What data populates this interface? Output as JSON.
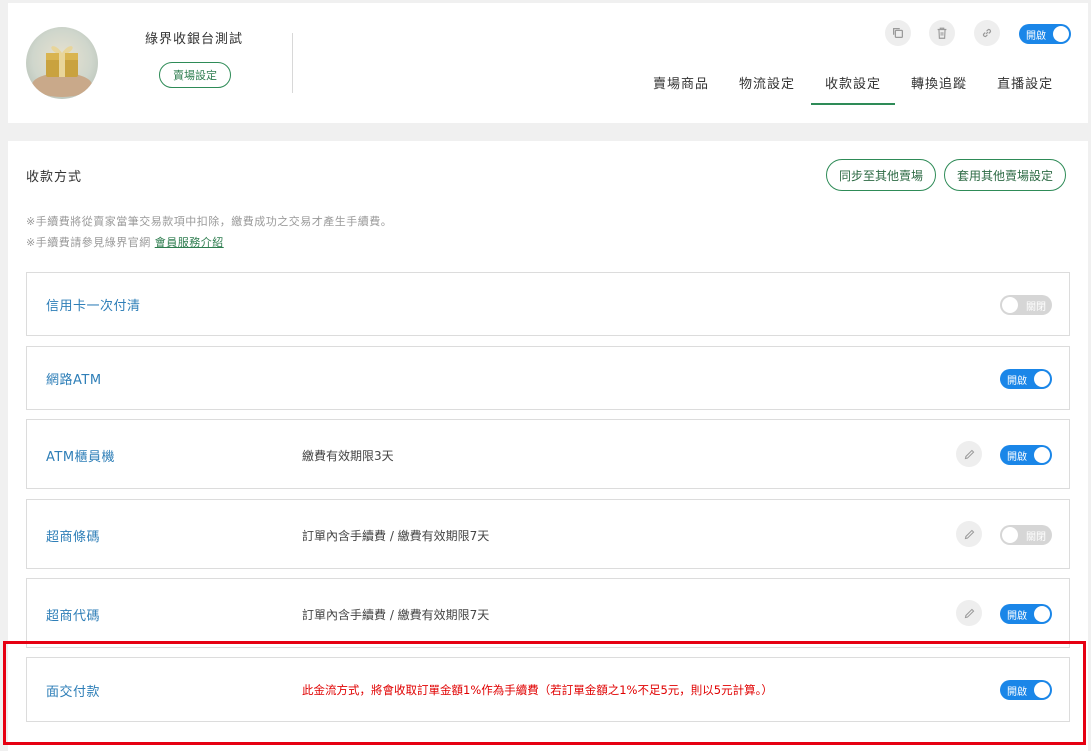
{
  "header": {
    "store_name": "綠界收銀台測試",
    "store_setting_label": "賣場設定",
    "status_toggle": {
      "state": "on",
      "label": "開啟"
    },
    "action_icons": [
      "copy-icon",
      "trash-icon",
      "link-icon"
    ],
    "tabs": [
      {
        "label": "賣場商品",
        "active": false
      },
      {
        "label": "物流設定",
        "active": false
      },
      {
        "label": "收款設定",
        "active": true
      },
      {
        "label": "轉換追蹤",
        "active": false
      },
      {
        "label": "直播設定",
        "active": false
      }
    ]
  },
  "main": {
    "title": "收款方式",
    "sync_button": "同步至其他賣場",
    "apply_button": "套用其他賣場設定",
    "note1": "※手續費將從賣家當筆交易款項中扣除，繳費成功之交易才產生手續費。",
    "note2_prefix": "※手續費請參見綠界官網",
    "note2_link": "會員服務介紹",
    "methods": [
      {
        "name": "信用卡一次付清",
        "desc": "",
        "editable": false,
        "toggle": "off",
        "toggle_label": "關閉"
      },
      {
        "name": "網路ATM",
        "desc": "",
        "editable": false,
        "toggle": "on",
        "toggle_label": "開啟"
      },
      {
        "name": "ATM櫃員機",
        "desc": "繳費有效期限3天",
        "editable": true,
        "toggle": "on",
        "toggle_label": "開啟"
      },
      {
        "name": "超商條碼",
        "desc": "訂單內含手續費 / 繳費有效期限7天",
        "editable": true,
        "toggle": "off",
        "toggle_label": "關閉"
      },
      {
        "name": "超商代碼",
        "desc": "訂單內含手續費 / 繳費有效期限7天",
        "editable": true,
        "toggle": "on",
        "toggle_label": "開啟"
      },
      {
        "name": "面交付款",
        "desc": "此金流方式，將會收取訂單金額1%作為手續費（若訂單金額之1%不足5元，則以5元計算。）",
        "editable": false,
        "toggle": "on",
        "toggle_label": "開啟",
        "warning": true
      }
    ]
  },
  "colors": {
    "accent_green": "#2e8b57",
    "toggle_on": "#1a86e8",
    "toggle_off": "#d6d6d6",
    "method_name": "#2f7fb8",
    "warning_red": "#e00000",
    "highlight_red": "#e60012"
  }
}
